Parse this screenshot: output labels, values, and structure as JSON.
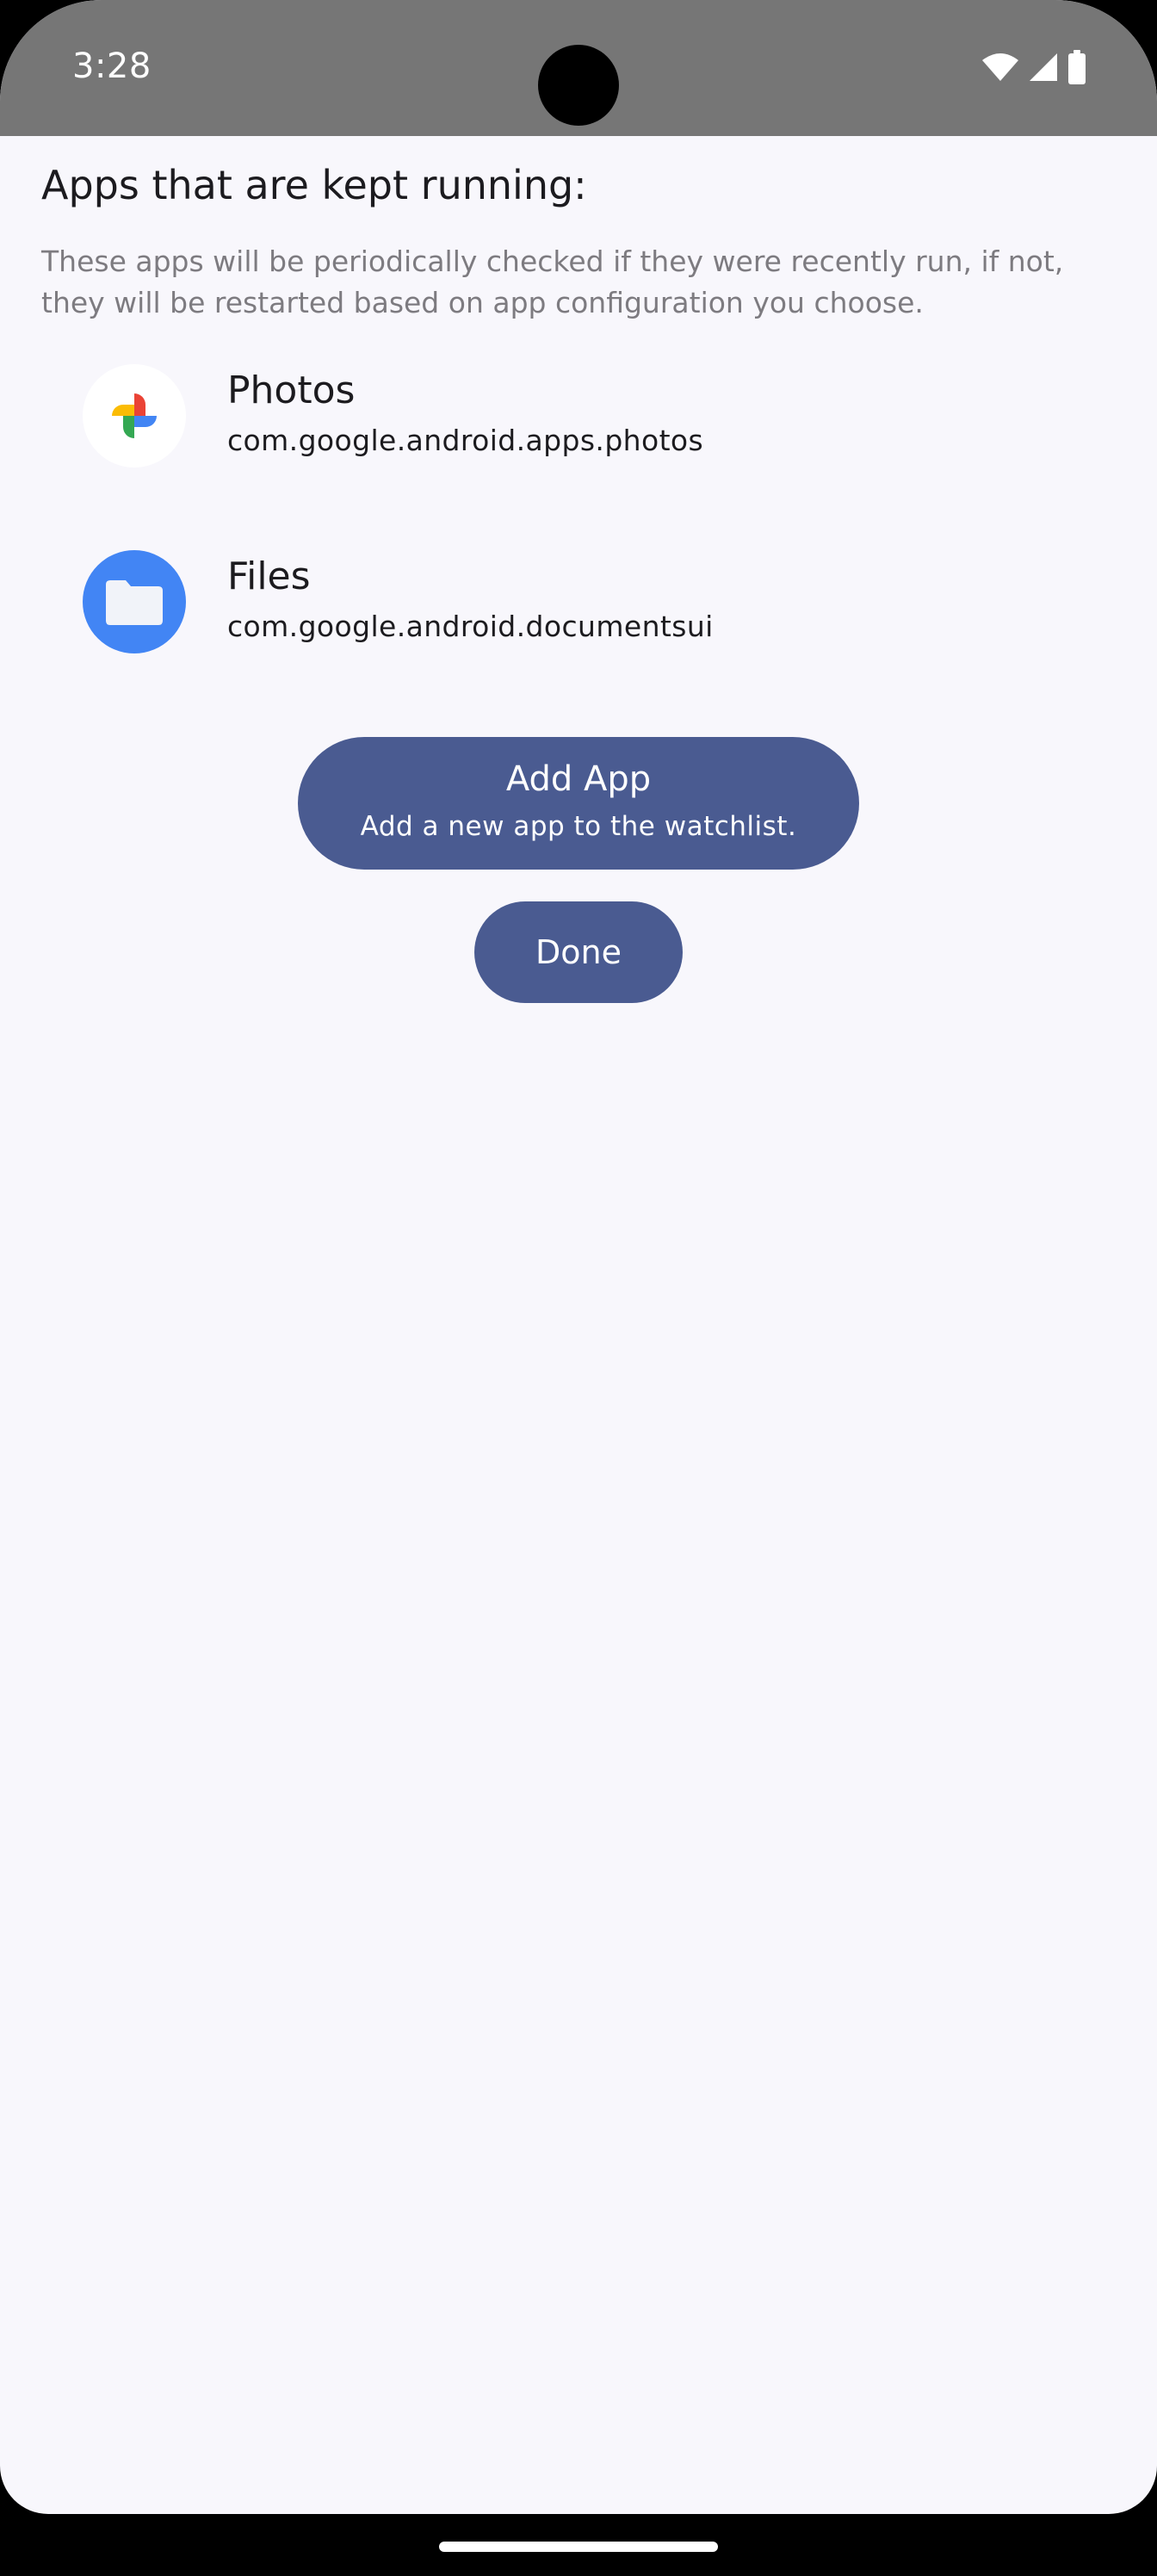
{
  "status_bar": {
    "time": "3:28",
    "icons": [
      "wifi-icon",
      "cellular-signal-icon",
      "battery-icon"
    ]
  },
  "page": {
    "heading": "Apps that are kept running:",
    "description": "These apps will be periodically checked if they were recently run, if not, they will be restarted based on app configuration you choose."
  },
  "apps": [
    {
      "name": "Photos",
      "package": "com.google.android.apps.photos",
      "icon": "google-photos-icon"
    },
    {
      "name": "Files",
      "package": "com.google.android.documentsui",
      "icon": "files-folder-icon"
    }
  ],
  "actions": {
    "add_app_label": "Add App",
    "add_app_sublabel": "Add a new app to the watchlist.",
    "done_label": "Done"
  },
  "colors": {
    "accent": "#4a5b91",
    "background": "#f8f7fc",
    "status_bar": "#767676",
    "text_primary": "#1c1b1f",
    "text_secondary": "#7d7b80"
  }
}
